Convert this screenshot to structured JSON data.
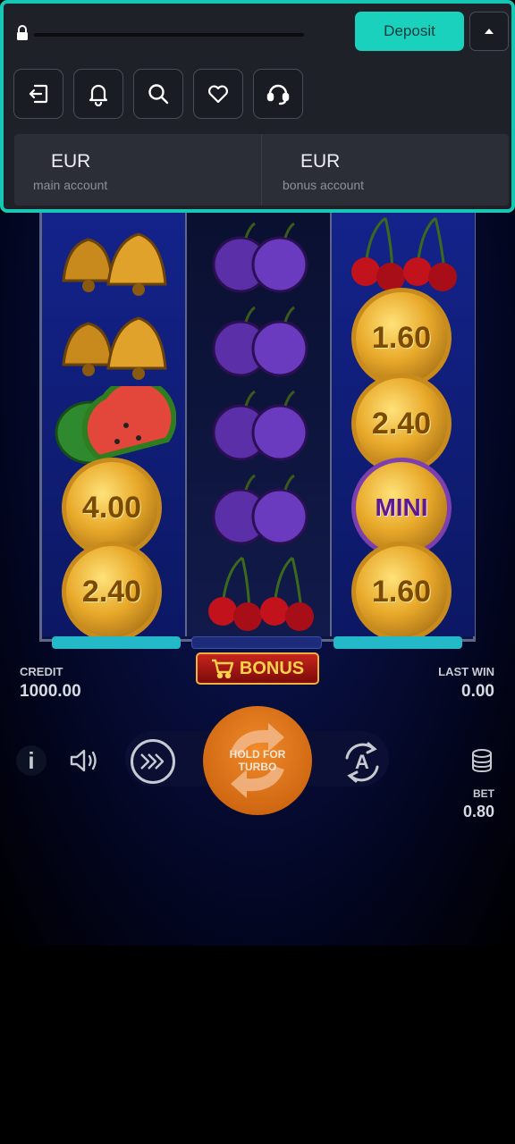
{
  "panel": {
    "deposit_label": "Deposit",
    "icons": [
      "logout-icon",
      "bell-icon",
      "search-icon",
      "heart-icon",
      "headset-icon"
    ],
    "accounts": [
      {
        "currency": "EUR",
        "label": "main account"
      },
      {
        "currency": "EUR",
        "label": "bonus account"
      }
    ],
    "accent_color": "#16c7b3"
  },
  "game": {
    "reels": [
      [
        "bell",
        "bell",
        "watermelon",
        "coin 4.00",
        "coin 2.40"
      ],
      [
        "plum",
        "plum",
        "plum",
        "plum",
        "cherry"
      ],
      [
        "cherry",
        "coin 1.60",
        "coin 2.40",
        "coin MINI",
        "coin 1.60"
      ]
    ],
    "coins": {
      "r1c4": "4.00",
      "r1c5": "2.40",
      "r3c2": "1.60",
      "r3c3": "2.40",
      "r3c4": "MINI",
      "r3c5": "1.60"
    },
    "bonus_label": "BONUS",
    "credit_label": "CREDIT",
    "credit_value": "1000.00",
    "last_win_label": "LAST WIN",
    "last_win_value": "0.00",
    "spin_label_1": "HOLD FOR",
    "spin_label_2": "TURBO",
    "bet_label": "BET",
    "bet_value": "0.80",
    "auto_letter": "A",
    "info_letter": "i"
  }
}
